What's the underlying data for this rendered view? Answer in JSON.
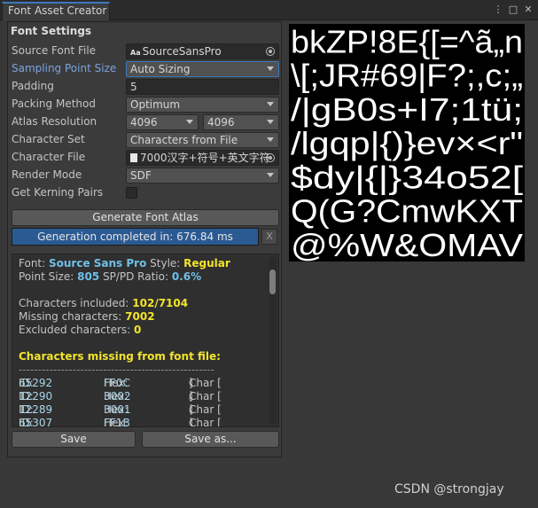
{
  "window": {
    "tab_title": "Font Asset Creator",
    "menu_icon": "kebab-menu-icon",
    "maximize_icon": "maximize-icon",
    "close_icon": "close-icon"
  },
  "settings": {
    "header": "Font Settings",
    "source_font_file": {
      "label": "Source Font File",
      "value": "SourceSansPro",
      "icon": "font-asset-icon"
    },
    "sampling_point_size": {
      "label": "Sampling Point Size",
      "value": "Auto Sizing"
    },
    "padding": {
      "label": "Padding",
      "value": "5"
    },
    "packing_method": {
      "label": "Packing Method",
      "value": "Optimum"
    },
    "atlas_resolution": {
      "label": "Atlas Resolution",
      "width": "4096",
      "height": "4096"
    },
    "character_set": {
      "label": "Character Set",
      "value": "Characters from File"
    },
    "character_file": {
      "label": "Character File",
      "value": "7000汉字+符号+英文字符",
      "icon": "text-file-icon"
    },
    "render_mode": {
      "label": "Render Mode",
      "value": "SDF"
    },
    "get_kerning_pairs": {
      "label": "Get Kerning Pairs",
      "checked": false
    }
  },
  "generate_button": "Generate Font Atlas",
  "progress": {
    "text": "Generation completed in: 676.84 ms",
    "fraction": 1.0,
    "clear_label": "X"
  },
  "report": {
    "font_label": "Font: ",
    "font_value": "Source Sans Pro",
    "style_label": "  Style: ",
    "style_value": "Regular",
    "point_size_label": "Point Size: ",
    "point_size_value": "805",
    "ratio_label": "   SP/PD Ratio: ",
    "ratio_value": "0.6%",
    "included_label": "Characters included: ",
    "included_value": "102/7104",
    "missing_label": "Missing characters: ",
    "missing_value": "7002",
    "excluded_label": "Excluded characters: ",
    "excluded_value": "0",
    "missing_header": "Characters missing from font file:",
    "separator": "---------------------------------------------------",
    "missing_rows": [
      {
        "id_label": "ID: ",
        "id": "65292",
        "hex_label": "Hex: ",
        "hex": "FF0C",
        "char_label": "Char [",
        "char": "，",
        "char_end": "]"
      },
      {
        "id_label": "ID: ",
        "id": "12290",
        "hex_label": "Hex: ",
        "hex": "3002",
        "char_label": "Char [",
        "char": "。",
        "char_end": "]"
      },
      {
        "id_label": "ID: ",
        "id": "12289",
        "hex_label": "Hex: ",
        "hex": "3001",
        "char_label": "Char [",
        "char": "、",
        "char_end": "]"
      },
      {
        "id_label": "ID: ",
        "id": "65307",
        "hex_label": "Hex: ",
        "hex": "FF1B",
        "char_label": "Char [",
        "char": "；",
        "char_end": "]"
      }
    ]
  },
  "save_button": "Save",
  "save_as_button": "Save as...",
  "atlas_rows": [
    "bkZP!8E{[=^ã„n",
    "\\[;JR#69|F?;,c;„",
    "/|gB0s+I7;1tü;",
    "/lgqp|{)}ev×<r\"",
    "$dy|{|}34o52[",
    "Q(G?CmwKXT",
    "@%W&OMAV"
  ],
  "watermark": "CSDN @strongjay"
}
